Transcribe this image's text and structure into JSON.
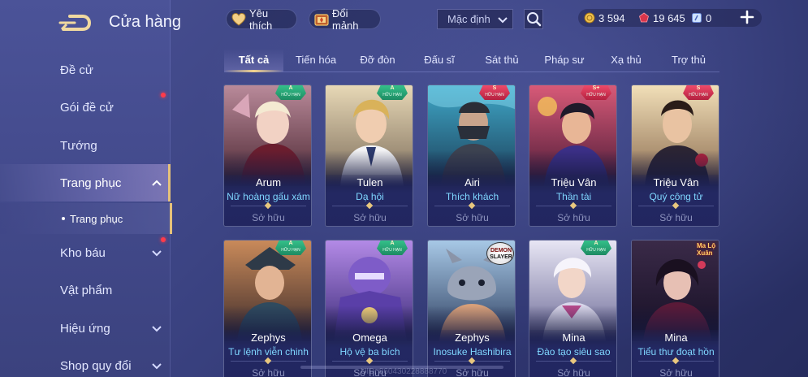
{
  "header": {
    "title": "Cửa hàng"
  },
  "sidebar": {
    "items": [
      {
        "label": "Đề cử"
      },
      {
        "label": "Gói đề cử"
      },
      {
        "label": "Tướng"
      },
      {
        "label": "Trang phục"
      },
      {
        "label": "Kho báu"
      },
      {
        "label": "Vật phẩm"
      },
      {
        "label": "Hiệu ứng"
      },
      {
        "label": "Shop quy đổi"
      }
    ],
    "sub_item": {
      "label": "Trang phục"
    }
  },
  "topbar": {
    "favorites_label": "Yêu thích",
    "shards_label": "Đổi mảnh",
    "sort": {
      "selected": "Mặc định"
    },
    "currencies": {
      "gold": "3 594",
      "gems": "19 645",
      "vouchers": "0"
    },
    "icons": {
      "back": "back-arrow-icon",
      "favorite": "heart-icon",
      "shards": "shard-chest-icon",
      "search": "search-icon",
      "gold": "gold-coin-icon",
      "gem": "red-gem-icon",
      "voucher": "voucher-icon",
      "add": "plus-icon"
    }
  },
  "tabs": [
    {
      "label": "Tất cả",
      "active": true
    },
    {
      "label": "Tiến hóa"
    },
    {
      "label": "Đỡ đòn"
    },
    {
      "label": "Đấu sĩ"
    },
    {
      "label": "Sát thủ"
    },
    {
      "label": "Pháp sư"
    },
    {
      "label": "Xạ thủ"
    },
    {
      "label": "Trợ thủ"
    }
  ],
  "cards": [
    {
      "hero": "Arum",
      "skin": "Nữ hoàng gấu xám",
      "status": "Sở hữu",
      "rank": "A",
      "limited": "HỮU HẠN"
    },
    {
      "hero": "Tulen",
      "skin": "Dạ hội",
      "status": "Sở hữu",
      "rank": "A",
      "limited": "HỮU HẠN"
    },
    {
      "hero": "Airi",
      "skin": "Thích khách",
      "status": "Sở hữu",
      "rank": "S",
      "limited": "HỮU HẠN"
    },
    {
      "hero": "Triệu Vân",
      "skin": "Thần tài",
      "status": "Sở hữu",
      "rank": "S+",
      "limited": "HỮU HẠN"
    },
    {
      "hero": "Triệu Vân",
      "skin": "Quý công tử",
      "status": "Sở hữu",
      "rank": "S",
      "limited": "HỮU HẠN"
    },
    {
      "hero": "Zephys",
      "skin": "Tư lệnh viễn chinh",
      "status": "Sở hữu",
      "rank": "A",
      "limited": "HỮU HẠN"
    },
    {
      "hero": "Omega",
      "skin": "Hộ vệ ba bích",
      "status": "Sở hữu",
      "rank": "A",
      "limited": "HỮU HẠN"
    },
    {
      "hero": "Zephys",
      "skin": "Inosuke Hashibira",
      "status": "Sở hữu",
      "logo_line1": "DEMON",
      "logo_line2": "SLAYER"
    },
    {
      "hero": "Mina",
      "skin": "Đào tạo siêu sao",
      "status": "Sở hữu",
      "rank": "A",
      "limited": "HỮU HẠN"
    },
    {
      "hero": "Mina",
      "skin": "Tiểu thư đoạt hồn",
      "status": "Sở hữu",
      "logo_text": "Ma Lộ Xuân"
    }
  ],
  "footer": {
    "watermark": "UID: 860430228888770"
  },
  "colors": {
    "accent_gold": "#e6c27a",
    "skin_name": "#7fd6ff",
    "notify_dot": "#ff3b4a"
  }
}
